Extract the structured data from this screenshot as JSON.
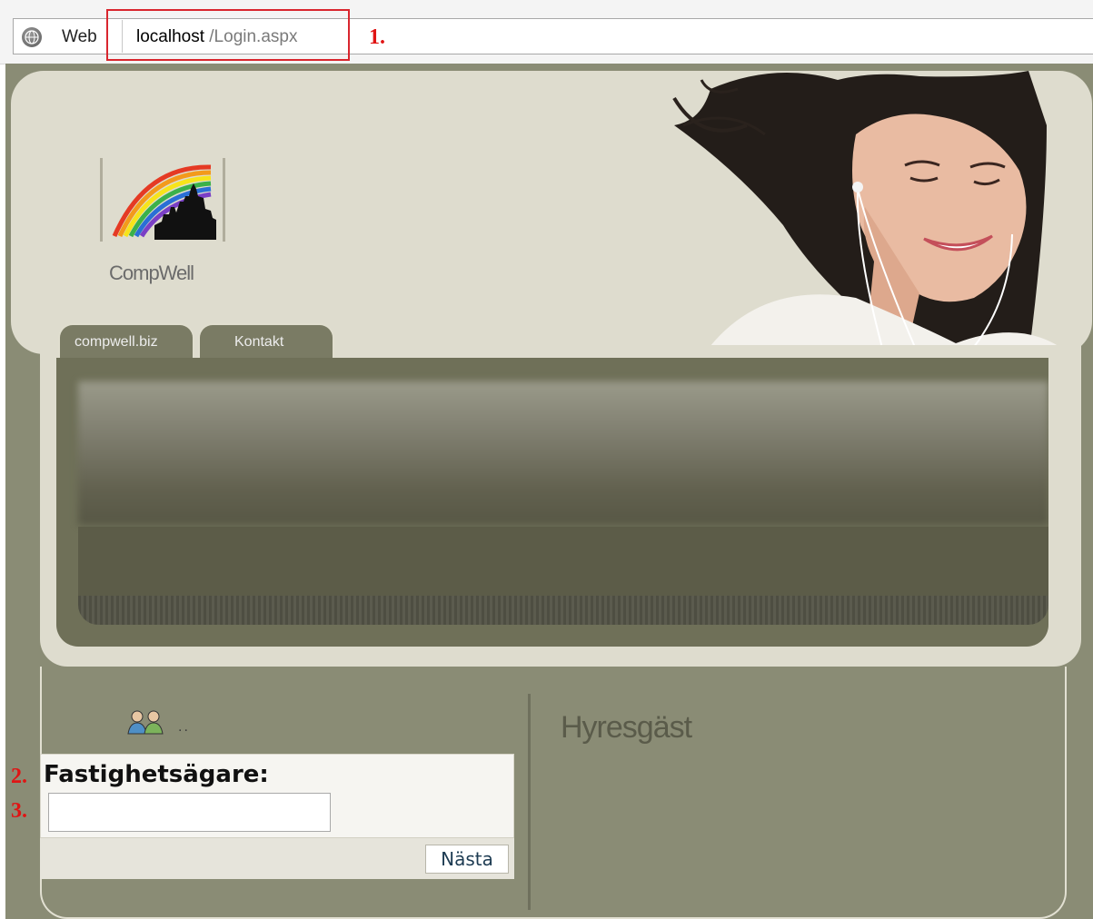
{
  "browser": {
    "web_label": "Web",
    "url_host": "localhost",
    "url_path": " /Login.aspx"
  },
  "annotations": {
    "a1": "1.",
    "a2": "2.",
    "a3": "3."
  },
  "logo": {
    "name": "CompWell"
  },
  "tabs": [
    {
      "label": "compwell.biz"
    },
    {
      "label": "Kontakt"
    }
  ],
  "login": {
    "users_dots": "..",
    "label": "Fastighetsägare:",
    "input_value": "",
    "next_label": "Nästa"
  },
  "tenant": {
    "title": "Hyresgäst"
  },
  "colors": {
    "annotation_red": "#e01414",
    "page_bg": "#8a8c75",
    "header_bg": "#dedcce"
  }
}
